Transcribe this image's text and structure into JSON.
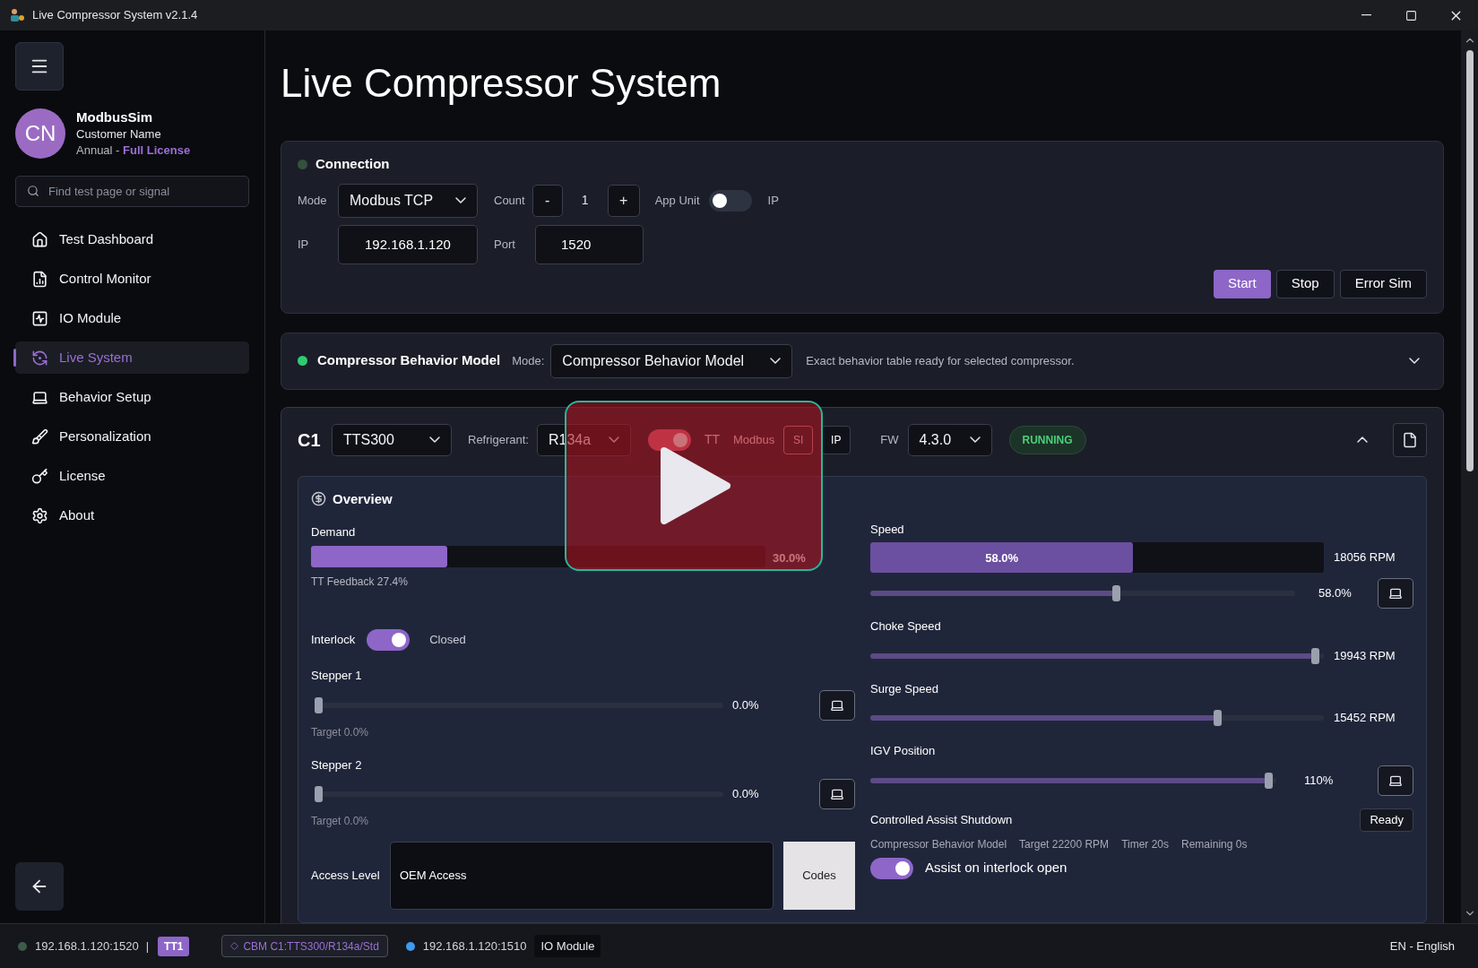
{
  "window": {
    "title": "Live Compressor System v2.1.4"
  },
  "sidebar": {
    "user": {
      "initials": "CN",
      "app": "ModbusSim",
      "customer": "Customer Name",
      "plan": "Annual - ",
      "license": "Full License"
    },
    "search": {
      "placeholder": "Find test page or signal"
    },
    "items": [
      {
        "label": "Test Dashboard",
        "selected": false
      },
      {
        "label": "Control Monitor",
        "selected": false
      },
      {
        "label": "IO Module",
        "selected": false
      },
      {
        "label": "Live System",
        "selected": true
      },
      {
        "label": "Behavior Setup",
        "selected": false
      },
      {
        "label": "Personalization",
        "selected": false
      },
      {
        "label": "License",
        "selected": false
      },
      {
        "label": "About",
        "selected": false
      }
    ]
  },
  "page_title": "Live Compressor System",
  "connection": {
    "title": "Connection",
    "active": false,
    "mode_label": "Mode",
    "mode": "Modbus TCP",
    "count_label": "Count",
    "minus": "-",
    "count": "1",
    "plus": "+",
    "app_unit_label": "App Unit",
    "app_unit_on": false,
    "app_unit_value": "IP",
    "ip_label": "IP",
    "ip": "192.168.1.120",
    "port_label": "Port",
    "port": "1520",
    "buttons": [
      {
        "label": "Start",
        "primary": true
      },
      {
        "label": "Stop",
        "primary": false
      },
      {
        "label": "Error Sim",
        "primary": false
      }
    ]
  },
  "behavior_model": {
    "title": "Compressor Behavior Model",
    "active": true,
    "mode_label": "Mode:",
    "mode": "Compressor Behavior Model",
    "note": "Exact behavior table ready for selected compressor.",
    "expanded": false
  },
  "compressor": {
    "name": "C1",
    "model": "TTS300",
    "refrigerant_label": "Refrigerant:",
    "refrigerant": "R134a",
    "tt_on": true,
    "tt_label": "TT",
    "modbus_label": "Modbus",
    "units": [
      {
        "label": "SI",
        "selected": true
      },
      {
        "label": "IP",
        "selected": false
      }
    ],
    "fw_label": "FW",
    "fw": "4.3.0",
    "status": "RUNNING",
    "expanded": true,
    "overview": {
      "title": "Overview",
      "demand": {
        "label": "Demand",
        "level": 0.3,
        "reading": "30.0%"
      },
      "tt_feedback": "TT Feedback 27.4%",
      "interlock": {
        "label": "Interlock",
        "on": true,
        "state": "Closed"
      },
      "steppers": [
        {
          "label": "Stepper 1",
          "level": 0,
          "reading": "0.0%",
          "target": "Target 0.0%"
        },
        {
          "label": "Stepper 2",
          "level": 0,
          "reading": "0.0%",
          "target": "Target 0.0%"
        }
      ],
      "access": {
        "label": "Access Level",
        "value": "OEM Access",
        "button": "Codes"
      },
      "speed": {
        "label": "Speed",
        "meter": {
          "level": 0.58,
          "reading": "58.0%"
        },
        "rpm": "18056 RPM",
        "slider": {
          "level": 0.58,
          "reading": "58.0%"
        }
      },
      "sliders": [
        {
          "label": "Choke Speed",
          "level": 0.99,
          "reading": "19943 RPM",
          "has_button": false
        },
        {
          "label": "Surge Speed",
          "level": 0.77,
          "reading": "15452 RPM",
          "has_button": false
        },
        {
          "label": "IGV Position",
          "level": 0.99,
          "reading": "110%",
          "has_button": true
        }
      ],
      "shutdown": {
        "title": "Controlled Assist Shutdown",
        "status": "Ready",
        "details": [
          "Compressor Behavior Model",
          "Target 22200 RPM",
          "Timer 20s",
          "Remaining 0s"
        ],
        "assist_on": true,
        "assist_label": "Assist on interlock open"
      }
    }
  },
  "status_bar": {
    "primary": {
      "address": "192.168.1.120:1520",
      "color": "#3d5a4a"
    },
    "separator": "|",
    "badge": "TT1",
    "model_tag": "CBM C1:TTS300/R134a/Std",
    "secondary": {
      "address": "192.168.1.120:1510",
      "color": "#3b9cf0"
    },
    "module": "IO Module",
    "language": "EN - English"
  }
}
